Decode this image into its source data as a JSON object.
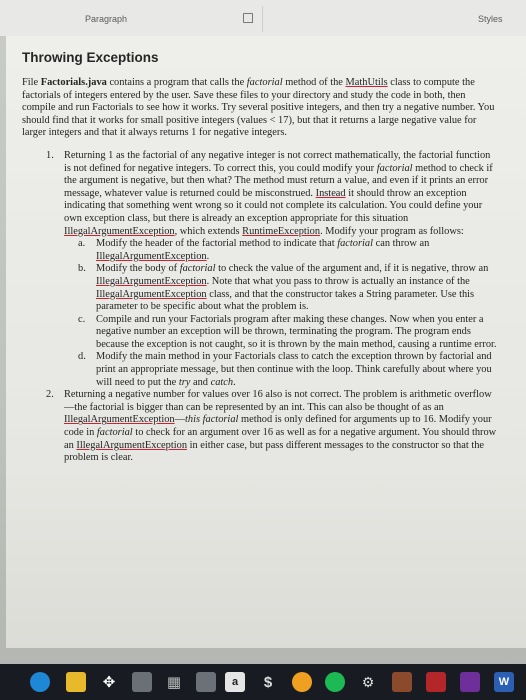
{
  "ribbon": {
    "paragraph_label": "Paragraph",
    "styles_label": "Styles"
  },
  "document": {
    "title": "Throwing Exceptions",
    "intro_parts": [
      "File ",
      "Factorials.java",
      " contains a program that calls the ",
      "factorial",
      " method of the ",
      "MathUtils",
      " class to compute the factorials of integers entered by the user. Save these files to your directory and study the code in both, then compile and run Factorials to see how it works. Try several positive integers, and then try a negative number. You should find that it works for small positive integers (values < 17), but that it returns a large negative value for larger integers and that it always returns 1 for negative integers."
    ],
    "item1": {
      "num": "1.",
      "parts": [
        "Returning 1 as the factorial of any negative integer is not correct mathematically, the factorial function is not defined for negative integers. To correct this, you could modify your ",
        "factorial",
        " method to check if the argument is negative, but then what? The method must return a value, and even if it prints an error message, whatever value is returned could be misconstrued. ",
        "Instead",
        " it should throw an exception indicating that something went wrong so it could not complete its calculation. You could define your own exception class, but there is already an exception appropriate for this situation ",
        "IllegalArgumentException",
        ", which extends ",
        "RuntimeException",
        ". Modify your program as follows:"
      ],
      "subs": [
        {
          "letter": "a.",
          "parts": [
            "Modify the header of the factorial method to indicate that ",
            "factorial",
            " can throw an ",
            "IllegalArgumentException",
            "."
          ]
        },
        {
          "letter": "b.",
          "parts": [
            "Modify the body of ",
            "factorial",
            " to check the value of the argument and, if it is negative, throw an ",
            "IllegalArgumentException",
            ". Note that what you pass to throw is actually an instance of the ",
            "IllegalArgumentException",
            " class, and that the constructor takes a String parameter. Use this parameter to be specific about what the problem is."
          ]
        },
        {
          "letter": "c.",
          "parts": [
            "Compile and run your Factorials program after making these changes. Now when you enter a negative number an exception will be thrown, terminating the program. The program ends because the exception is not caught, so it is thrown by the main method, causing a runtime error."
          ]
        },
        {
          "letter": "d.",
          "parts": [
            "Modify the main method in your Factorials class to catch the exception thrown by factorial and print an appropriate message, but then continue with the loop. Think carefully about where you will need to put the ",
            "try",
            " and ",
            "catch",
            "."
          ]
        }
      ]
    },
    "item2": {
      "num": "2.",
      "parts": [
        "Returning a negative number for values over 16 also is not correct. The problem is arithmetic overflow—the factorial is bigger than can be represented by an int. This can also be thought of as an ",
        "IllegalArgumentException",
        "—",
        "this factorial",
        " method is only defined for arguments up to 16. Modify your code in ",
        "factorial",
        " to check for an argument over 16 as well as for a negative argument. You should throw an ",
        "IllegalArgumentException",
        " in either case, but pass different messages to the constructor so that the problem is clear."
      ]
    }
  },
  "taskbar": {
    "store_letter": "a",
    "word_letter": "W"
  },
  "colors": {
    "underline": "#c22233",
    "taskbar_bg": "#181b22",
    "edge_blue": "#1e88d6",
    "chrome_orange": "#f0a020",
    "spotify_green": "#1db954",
    "word_blue": "#2b5fb3"
  }
}
